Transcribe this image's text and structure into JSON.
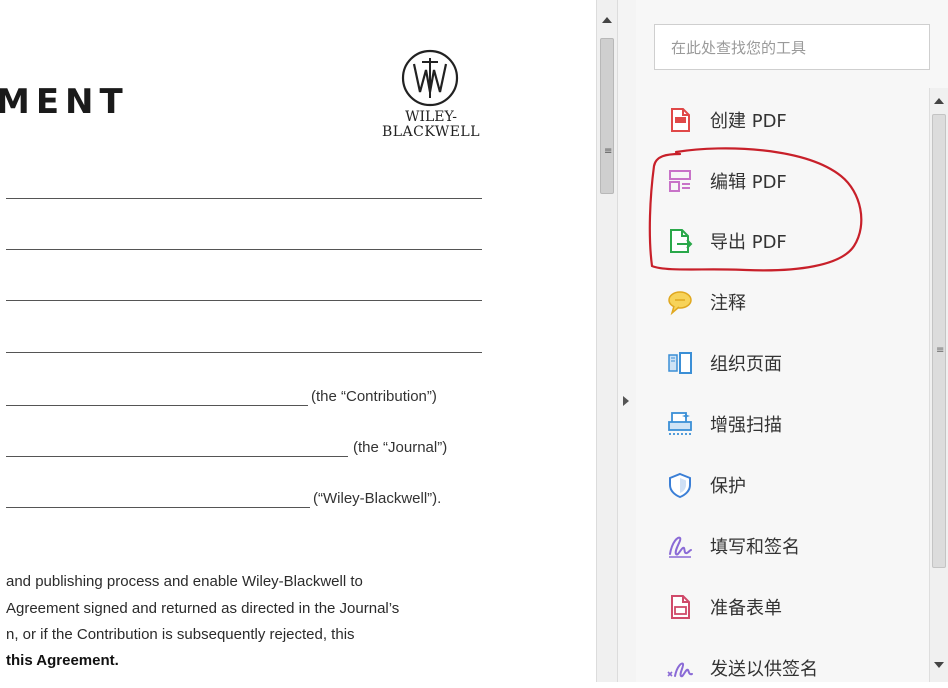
{
  "document": {
    "title_fragment": "MENT",
    "publisher_logo": {
      "line1": "WILEY-",
      "line2": "BLACKWELL"
    },
    "field_suffixes": [
      "(the “Contribution”)",
      "(the “Journal”)",
      "(“Wiley-Blackwell”)."
    ],
    "paragraph_lines": [
      "and publishing process and enable Wiley-Blackwell to",
      "Agreement signed and returned as directed in the Journal’s",
      "n, or if the Contribution is subsequently rejected, this"
    ],
    "bold_line": "this Agreement."
  },
  "tools_pane": {
    "search_placeholder": "在此处查找您的工具",
    "tools": [
      {
        "label": "创建 PDF",
        "icon": "create-pdf-icon",
        "color": "#e04848"
      },
      {
        "label": "编辑 PDF",
        "icon": "edit-pdf-icon",
        "color": "#c873c8"
      },
      {
        "label": "导出 PDF",
        "icon": "export-pdf-icon",
        "color": "#2aa84a"
      },
      {
        "label": "注释",
        "icon": "comment-icon",
        "color": "#f2c230"
      },
      {
        "label": "组织页面",
        "icon": "organize-pages-icon",
        "color": "#3b8fd6"
      },
      {
        "label": "增强扫描",
        "icon": "enhance-scan-icon",
        "color": "#3b8fd6"
      },
      {
        "label": "保护",
        "icon": "protect-icon",
        "color": "#3b7fd6"
      },
      {
        "label": "填写和签名",
        "icon": "fill-sign-icon",
        "color": "#8a6ad6"
      },
      {
        "label": "准备表单",
        "icon": "prepare-form-icon",
        "color": "#d04a6a"
      },
      {
        "label": "发送以供签名",
        "icon": "send-for-signature-icon",
        "color": "#8a6ad6"
      }
    ]
  },
  "annotation": {
    "color": "#c8202a"
  }
}
